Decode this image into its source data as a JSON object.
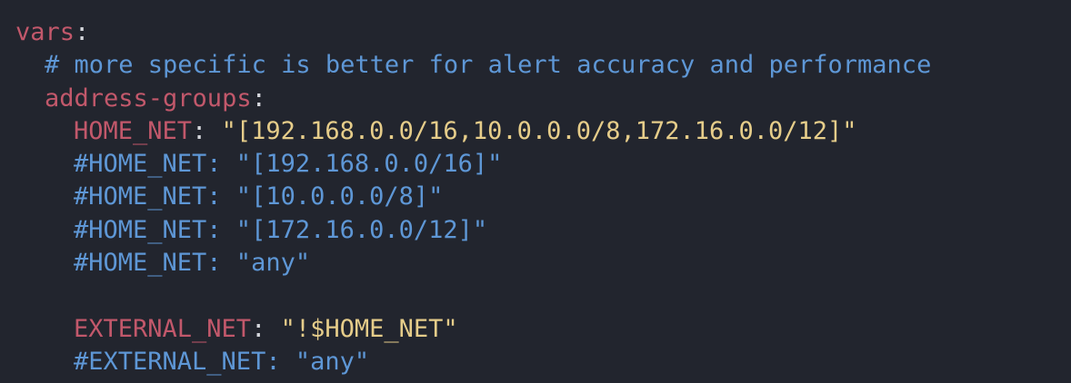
{
  "code": {
    "l1": {
      "key": "vars",
      "colon": ":"
    },
    "l2": {
      "comment": "# more specific is better for alert accuracy and performance"
    },
    "l3": {
      "key": "address-groups",
      "colon": ":"
    },
    "l4": {
      "key": "HOME_NET",
      "sep": ": ",
      "value": "\"[192.168.0.0/16,10.0.0.0/8,172.16.0.0/12]\""
    },
    "l5": {
      "comment": "#HOME_NET: \"[192.168.0.0/16]\""
    },
    "l6": {
      "comment": "#HOME_NET: \"[10.0.0.0/8]\""
    },
    "l7": {
      "comment": "#HOME_NET: \"[172.16.0.0/12]\""
    },
    "l8": {
      "comment": "#HOME_NET: \"any\""
    },
    "l10": {
      "key": "EXTERNAL_NET",
      "sep": ": ",
      "value": "\"!$HOME_NET\""
    },
    "l11": {
      "comment": "#EXTERNAL_NET: \"any\""
    }
  },
  "colors": {
    "background": "#22252e",
    "key": "#c2586b",
    "comment": "#5e97d6",
    "string": "#e6cd8a",
    "punctuation": "#d4d6dc"
  }
}
